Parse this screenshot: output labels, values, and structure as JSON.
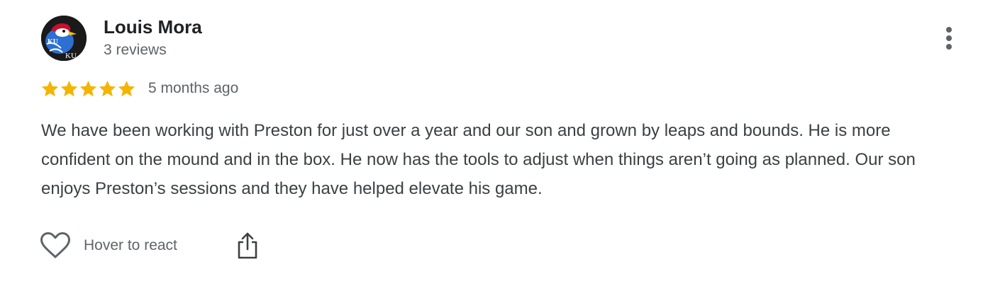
{
  "review": {
    "author": {
      "name": "Louis Mora",
      "review_count": "3 reviews",
      "avatar_text": [
        "KU",
        "KU"
      ]
    },
    "rating": 5,
    "rating_max": 5,
    "star_color": "#f4b400",
    "time": "5 months ago",
    "text": "We have been working with Preston for just over a year and our son and grown by leaps and bounds. He is more confident on the mound and in the box. He now has the tools to adjust when things aren’t going as planned. Our son enjoys Preston’s sessions and they have helped elevate his game.",
    "actions": {
      "react_label": "Hover to react",
      "react_icon": "heart-outline-icon",
      "share_icon": "share-icon",
      "more_icon": "more-vertical-icon"
    }
  }
}
